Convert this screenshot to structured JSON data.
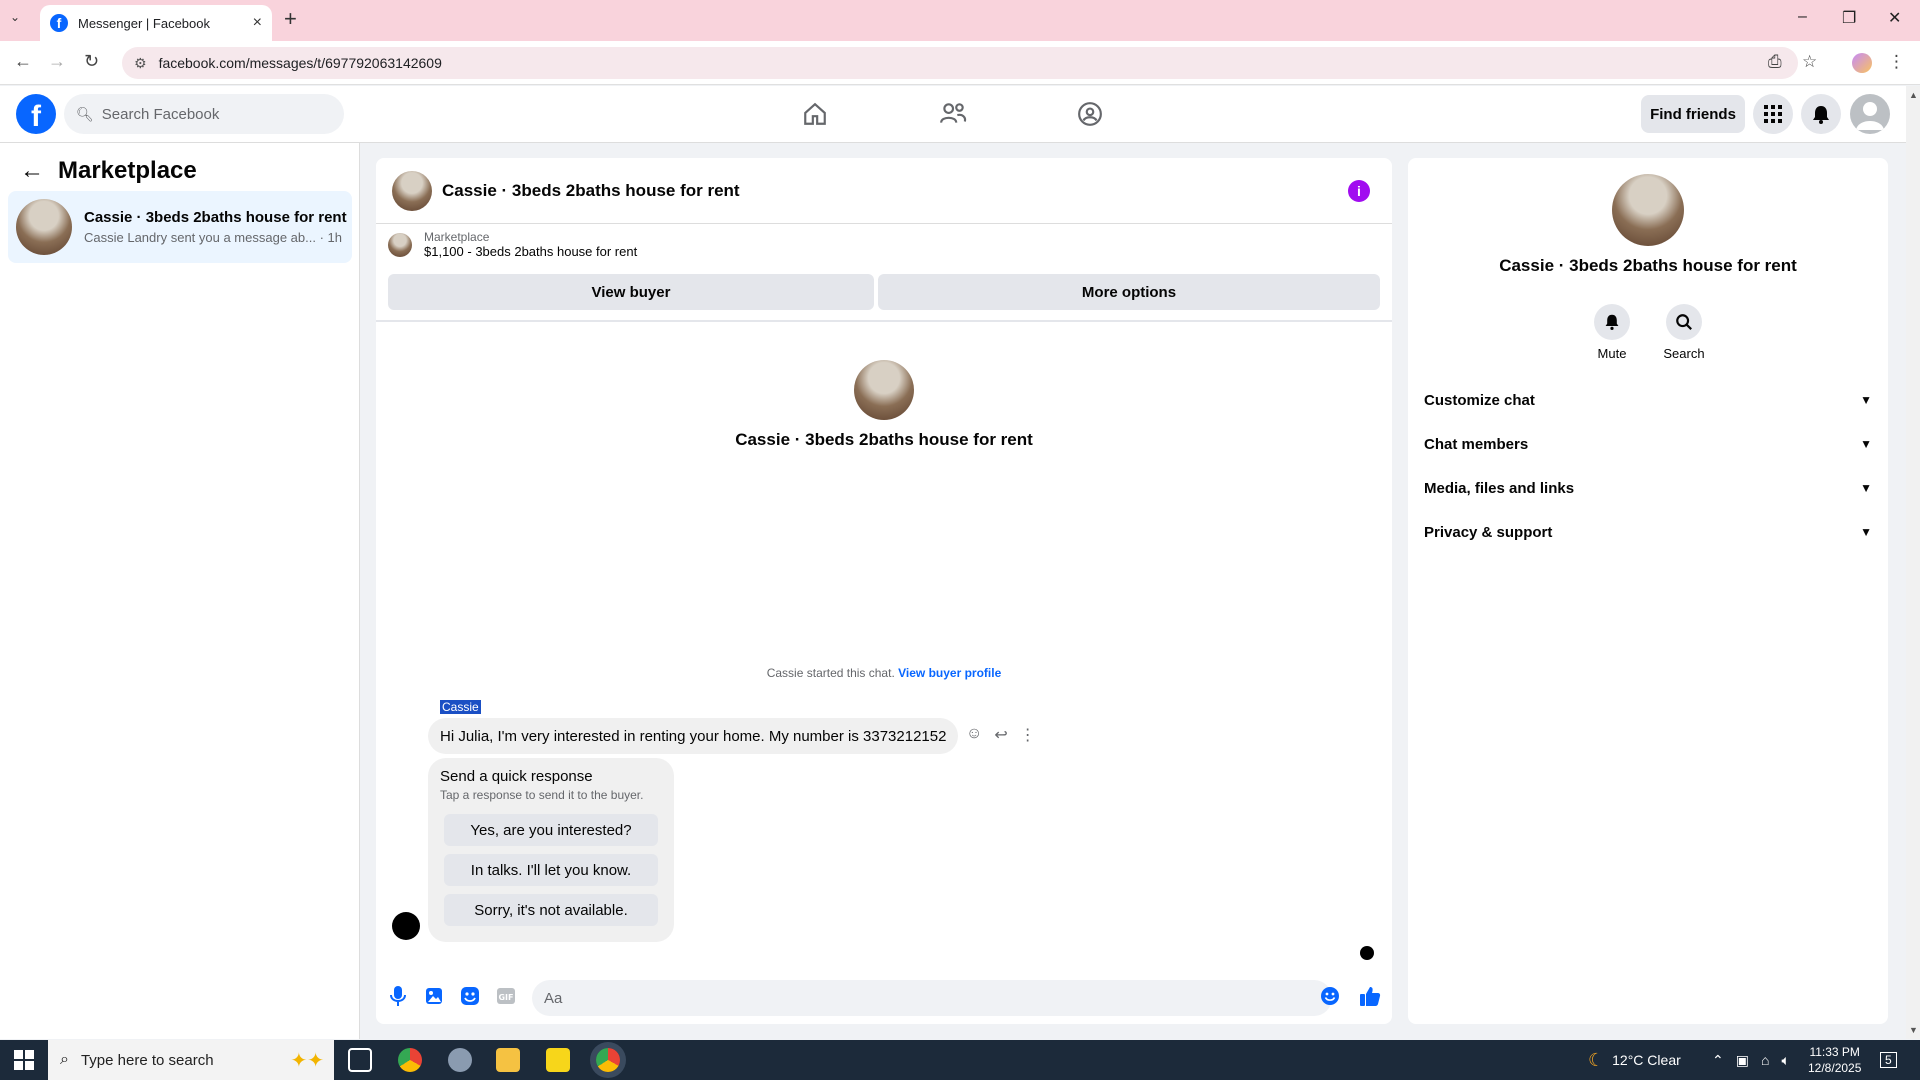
{
  "browser": {
    "tab_title": "Messenger | Facebook",
    "url": "facebook.com/messages/t/697792063142609"
  },
  "fb": {
    "search_placeholder": "Search Facebook",
    "find_friends": "Find friends"
  },
  "left": {
    "title": "Marketplace",
    "conversations": [
      {
        "name": "Cassie · 3beds 2baths house for rent",
        "preview": "Cassie Landry sent you a message ab...",
        "time": "· 1h"
      }
    ]
  },
  "chat": {
    "title": "Cassie · 3beds 2baths house for rent",
    "listing_label": "Marketplace",
    "listing_title": "$1,100 - 3beds 2baths house for rent",
    "view_buyer": "View buyer",
    "more_options": "More options",
    "profile_name": "Cassie · 3beds 2baths house for rent",
    "started_text": "Cassie started this chat.",
    "view_buyer_profile": "View buyer profile",
    "sender": "Cassie",
    "message": "Hi Julia, I'm very interested in renting your home. My number is 3373212152",
    "quick_title": "Send a quick response",
    "quick_subtitle": "Tap a response to send it to the buyer.",
    "quick_responses": [
      "Yes, are you interested?",
      "In talks. I'll let you know.",
      "Sorry, it's not available."
    ],
    "input_placeholder": "Aa"
  },
  "info": {
    "name": "Cassie · 3beds 2baths house for rent",
    "mute": "Mute",
    "search": "Search",
    "sections": [
      "Customize chat",
      "Chat members",
      "Media, files and links",
      "Privacy & support"
    ]
  },
  "taskbar": {
    "search_placeholder": "Type here to search",
    "weather": "12°C  Clear",
    "time": "11:33 PM",
    "date": "12/8/2025",
    "notif_count": "5"
  },
  "colors": {
    "fb_blue": "#0866ff",
    "chrome_title": "#f9d3dc",
    "info_purple": "#a10cf0"
  }
}
